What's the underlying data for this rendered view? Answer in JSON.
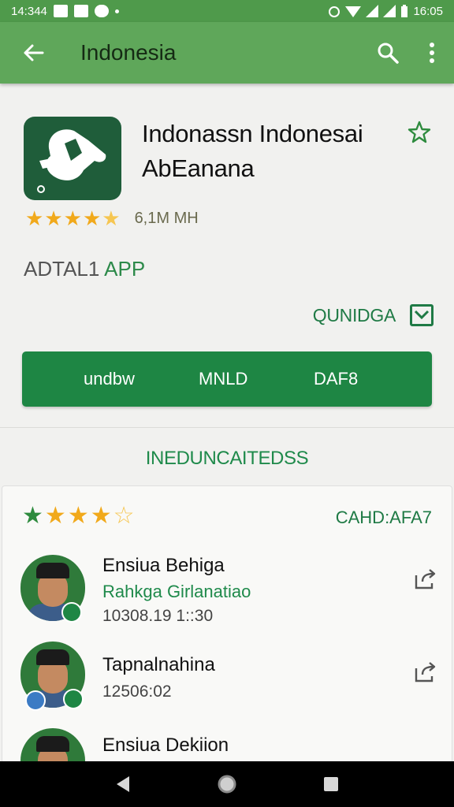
{
  "status_bar": {
    "time_left": "14:344",
    "time_right": "16:05"
  },
  "app_bar": {
    "title": "Indonesia"
  },
  "app": {
    "name": "Indonassn Indonesai AbEanana",
    "rating": 4.5,
    "downloads": "6,1M MH",
    "category_prefix": "ADTAL1",
    "category": "APP"
  },
  "secondary_action": {
    "label": "QUNIDGA"
  },
  "button_bar": {
    "segments": [
      "undbw",
      "MNLD",
      "DAF8"
    ]
  },
  "section": {
    "title": "INEDUNCAITEDSS"
  },
  "reviews": {
    "rating": 4.5,
    "action_label": "CAHD:AFA7",
    "items": [
      {
        "name": "Ensiua Behiga",
        "subtitle": "Rahkga Girlanatiao",
        "meta": "10308.19 1::30"
      },
      {
        "name": "Tapnalnahina",
        "subtitle": "",
        "meta": "12506:02"
      },
      {
        "name": "Ensiua Dekiion",
        "subtitle": "",
        "meta": ""
      }
    ]
  },
  "colors": {
    "status_bar": "#4f9a4b",
    "app_bar": "#5fa75a",
    "primary_green": "#1e8644",
    "star": "#f1a91b"
  }
}
